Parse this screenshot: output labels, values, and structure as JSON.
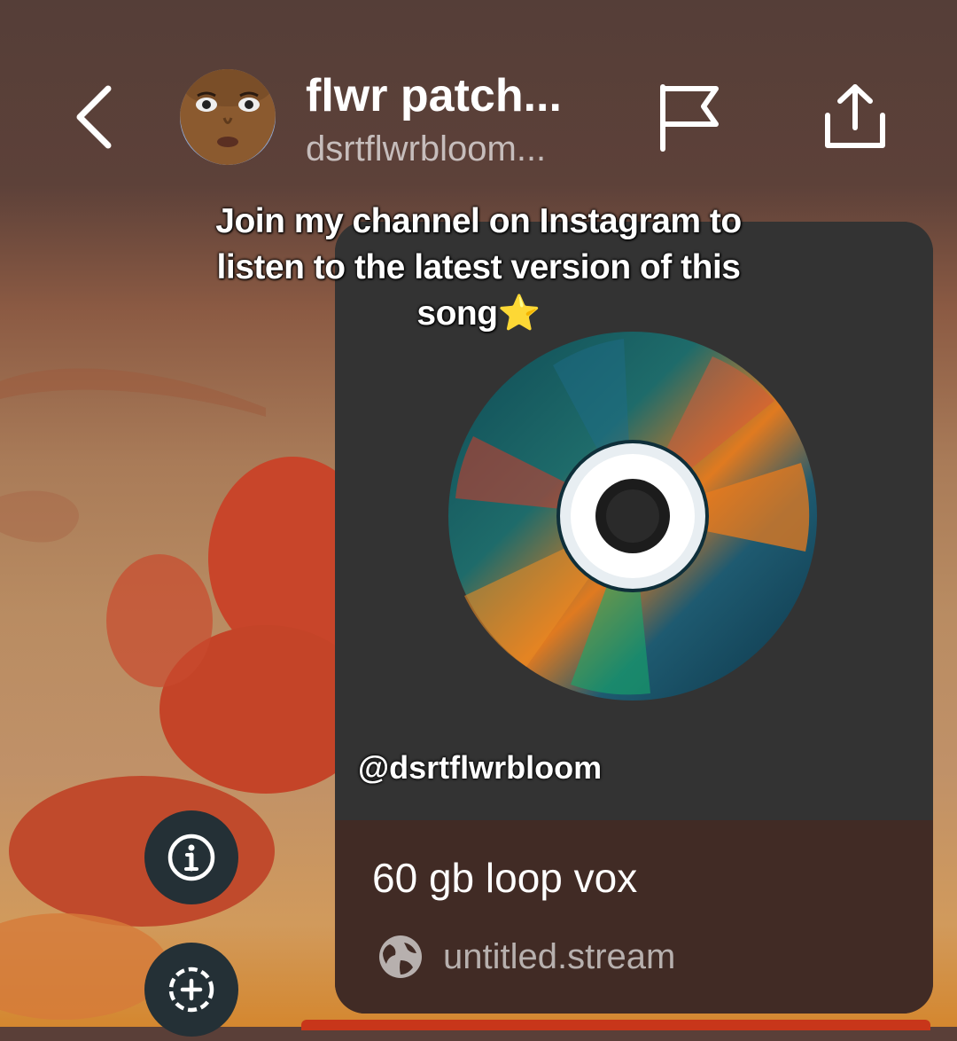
{
  "header": {
    "title": "flwr patch...",
    "subtitle": "dsrtflwrbloom..."
  },
  "caption": {
    "line1": "Join my channel on Instagram to",
    "line2": "listen to the latest version of this",
    "line3": "song",
    "emoji": "⭐"
  },
  "card": {
    "handle": "@dsrtflwrbloom",
    "song_title": "60 gb loop vox",
    "link": "untitled.stream"
  },
  "icons": {
    "back": "chevron-left-icon",
    "flag": "flag-icon",
    "share": "share-icon",
    "info": "info-icon",
    "add": "add-circle-icon",
    "globe": "globe-icon"
  },
  "colors": {
    "card_top": "#333333",
    "card_bottom": "#412b25",
    "side_button": "#243036",
    "flower": "#c8452a"
  }
}
